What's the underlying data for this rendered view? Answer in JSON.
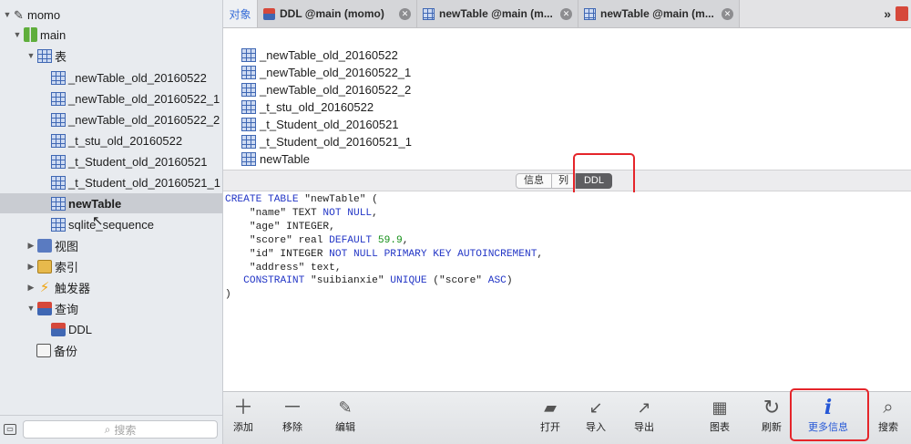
{
  "sidebar": {
    "connection": "momo",
    "database": "main",
    "tables_group": "表",
    "tables": [
      "_newTable_old_20160522",
      "_newTable_old_20160522_1",
      "_newTable_old_20160522_2",
      "_t_stu_old_20160522",
      "_t_Student_old_20160521",
      "_t_Student_old_20160521_1",
      "newTable",
      "sqlite_sequence"
    ],
    "selected_table": "newTable",
    "views": "视图",
    "indexes": "索引",
    "triggers": "触发器",
    "queries": "查询",
    "query_items": [
      "DDL"
    ],
    "backups": "备份",
    "search_placeholder": "搜索"
  },
  "tabs": {
    "objects_label": "对象",
    "items": [
      {
        "label": "DDL @main (momo)"
      },
      {
        "label": "newTable @main (m..."
      },
      {
        "label": "newTable @main (m..."
      }
    ],
    "overflow": "»"
  },
  "object_list": [
    "_newTable_old_20160522",
    "_newTable_old_20160522_1",
    "_newTable_old_20160522_2",
    "_t_stu_old_20160522",
    "_t_Student_old_20160521",
    "_t_Student_old_20160521_1",
    "newTable"
  ],
  "segments": {
    "info": "信息",
    "columns": "列",
    "ddl": "DDL",
    "active": "DDL"
  },
  "ddl_lines": [
    [
      {
        "t": "CREATE TABLE ",
        "k": "kw"
      },
      {
        "t": "\"newTable\" (",
        "k": ""
      }
    ],
    [
      {
        "t": "    \"name\" TEXT ",
        "k": ""
      },
      {
        "t": "NOT NULL",
        "k": "kw"
      },
      {
        "t": ",",
        "k": ""
      }
    ],
    [
      {
        "t": "    \"age\" INTEGER,",
        "k": ""
      }
    ],
    [
      {
        "t": "    \"score\" real ",
        "k": ""
      },
      {
        "t": "DEFAULT ",
        "k": "kw"
      },
      {
        "t": "59.9",
        "k": "num"
      },
      {
        "t": ",",
        "k": ""
      }
    ],
    [
      {
        "t": "    \"id\" INTEGER ",
        "k": ""
      },
      {
        "t": "NOT NULL PRIMARY KEY AUTOINCREMENT",
        "k": "kw"
      },
      {
        "t": ",",
        "k": ""
      }
    ],
    [
      {
        "t": "    \"address\" text,",
        "k": ""
      }
    ],
    [
      {
        "t": "   ",
        "k": ""
      },
      {
        "t": "CONSTRAINT ",
        "k": "kw"
      },
      {
        "t": "\"suibianxie\" ",
        "k": ""
      },
      {
        "t": "UNIQUE ",
        "k": "kw"
      },
      {
        "t": "(\"score\" ",
        "k": ""
      },
      {
        "t": "ASC",
        "k": "kw"
      },
      {
        "t": ")",
        "k": ""
      }
    ],
    [
      {
        "t": ")",
        "k": ""
      }
    ]
  ],
  "toolbar": {
    "add": "添加",
    "remove": "移除",
    "edit": "编辑",
    "open": "打开",
    "import": "导入",
    "export": "导出",
    "chart": "图表",
    "refresh": "刷新",
    "more_info": "更多信息",
    "search": "搜索"
  },
  "colors": {
    "highlight": "#e5252a",
    "keyword": "#2336c6",
    "number": "#138f17",
    "accent": "#2557d6"
  }
}
